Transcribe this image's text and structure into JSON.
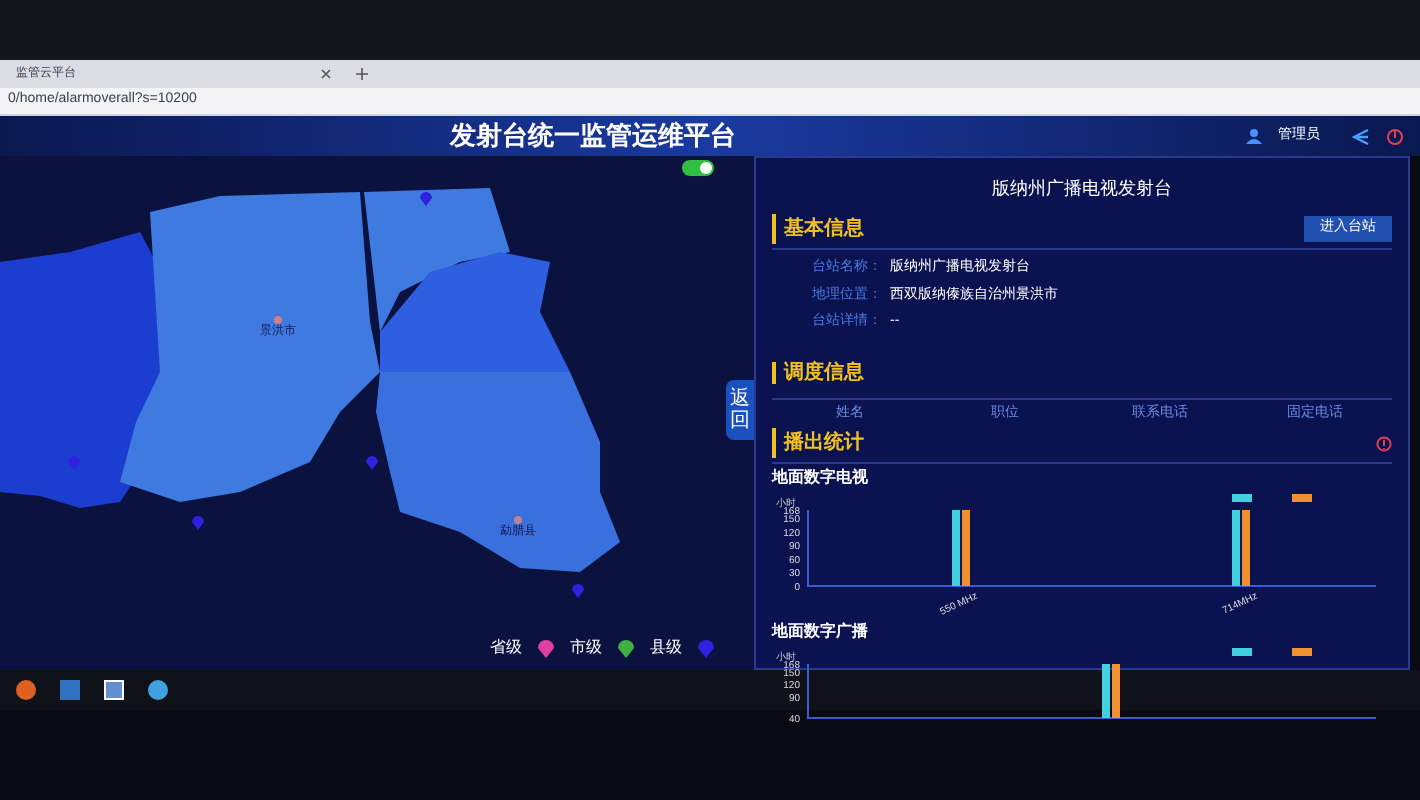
{
  "browser": {
    "tab_title": "监管云平台",
    "url": "0/home/alarmoverall?s=10200"
  },
  "header": {
    "title": "发射台统一监管运维平台",
    "user": "管理员"
  },
  "map": {
    "toggle": {
      "on": true
    },
    "places": [
      {
        "name": "景洪市",
        "kind": "city"
      },
      {
        "name": "勐腊县",
        "kind": "county"
      }
    ],
    "back_button": "返回",
    "legend": [
      {
        "label": "省级",
        "color": "#e040a0"
      },
      {
        "label": "市级",
        "color": "#40b040"
      },
      {
        "label": "县级",
        "color": "#3020e0"
      }
    ]
  },
  "station": {
    "title": "版纳州广播电视发射台",
    "basic_info": {
      "heading": "基本信息",
      "button": "进入台站",
      "fields": [
        {
          "label": "台站名称：",
          "value": "版纳州广播电视发射台"
        },
        {
          "label": "地理位置：",
          "value": "西双版纳傣族自治州景洪市"
        },
        {
          "label": "台站详情：",
          "value": "--"
        }
      ]
    },
    "dispatch": {
      "heading": "调度信息",
      "columns": [
        "姓名",
        "职位",
        "联系电话",
        "固定电话"
      ]
    },
    "stats": {
      "heading": "播出统计",
      "charts": [
        {
          "title": "地面数字电视",
          "chart_data": {
            "type": "bar",
            "ylabel": "小时",
            "categories": [
              "550 MHz",
              "714MHz"
            ],
            "ylim": [
              0,
              168
            ],
            "yticks": [
              0,
              30,
              60,
              90,
              120,
              150,
              168
            ],
            "series": [
              {
                "color": "#40d0e0",
                "values": [
                  168,
                  168
                ]
              },
              {
                "color": "#f09030",
                "values": [
                  168,
                  168
                ]
              }
            ]
          }
        },
        {
          "title": "地面数字广播",
          "chart_data": {
            "type": "bar",
            "ylabel": "小时",
            "categories": [
              null
            ],
            "ylim": [
              40,
              168
            ],
            "yticks": [
              40,
              90,
              120,
              150,
              168
            ],
            "series": [
              {
                "color": "#40d0e0",
                "values": [
                  168
                ]
              },
              {
                "color": "#f09030",
                "values": [
                  168
                ]
              }
            ]
          }
        }
      ]
    }
  }
}
